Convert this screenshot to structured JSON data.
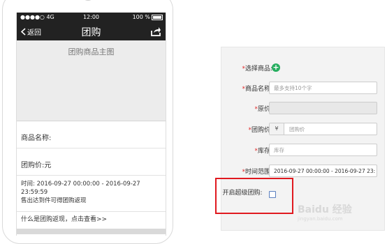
{
  "status_bar": {
    "signal": "●●●●○ 4G",
    "time": "12:00",
    "battery": "100 %"
  },
  "nav": {
    "back_label": "返回",
    "title": "团购"
  },
  "banner": {
    "text": "团购商品主图"
  },
  "product": {
    "name_label": "商品名称:",
    "price_label": "团购价:元",
    "time_line1": "时间: 2016-09-27 00:00:00 - 2016-09-27",
    "time_line2": "23:59:59",
    "rule_text": "售出达到件可得团购返现",
    "link_text": "什么是团购返现，点击查看>>"
  },
  "form": {
    "select_product_label": "选择商品:",
    "product_name_label": "商品名称:",
    "product_name_placeholder": "最多支持10个字",
    "original_price_label": "原价:",
    "group_price_label": "团购价:",
    "currency_symbol": "¥",
    "group_price_placeholder": "团购价",
    "stock_label": "库存:",
    "stock_placeholder": "库存",
    "time_range_label": "时间范围:",
    "time_range_value": "2016-09-27 00:00:00 - 2016-09-27 23:",
    "super_group_label": "开启超级团购:",
    "super_group_checked": false
  },
  "watermark": {
    "text": "Baidu 经验",
    "sub": "jingyan.baidu.com"
  },
  "colors": {
    "nav_bg": "#222222",
    "add_button": "#27ae60",
    "required": "#e02b2b",
    "highlight_border": "#e0191f"
  }
}
